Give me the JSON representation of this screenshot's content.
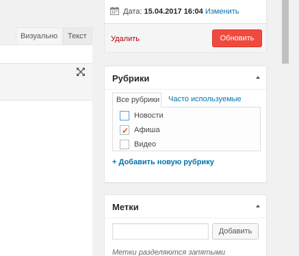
{
  "editor": {
    "tabs": [
      {
        "label": "Визуально"
      },
      {
        "label": "Текст"
      }
    ],
    "expand_icon": "fullscreen-icon"
  },
  "publish": {
    "date_label": "Дата:",
    "date_value": "15.04.2017 16:04",
    "edit_link": "Изменить",
    "delete_link": "Удалить",
    "update_button": "Обновить",
    "calendar_icon": "calendar-icon"
  },
  "categories": {
    "title": "Рубрики",
    "tab_all": "Все рубрики",
    "tab_popular": "Часто используемые",
    "items": [
      {
        "label": "Новости",
        "checked": false
      },
      {
        "label": "Афиша",
        "checked": true
      },
      {
        "label": "Видео",
        "checked": false
      }
    ],
    "add_link": "+ Добавить новую рубрику"
  },
  "tags": {
    "title": "Метки",
    "input_value": "",
    "add_button": "Добавить",
    "hint": "Метки разделяются запятыми"
  },
  "colors": {
    "update_button": "#f04a3e",
    "link": "#0073aa",
    "delete": "#aa0000"
  }
}
